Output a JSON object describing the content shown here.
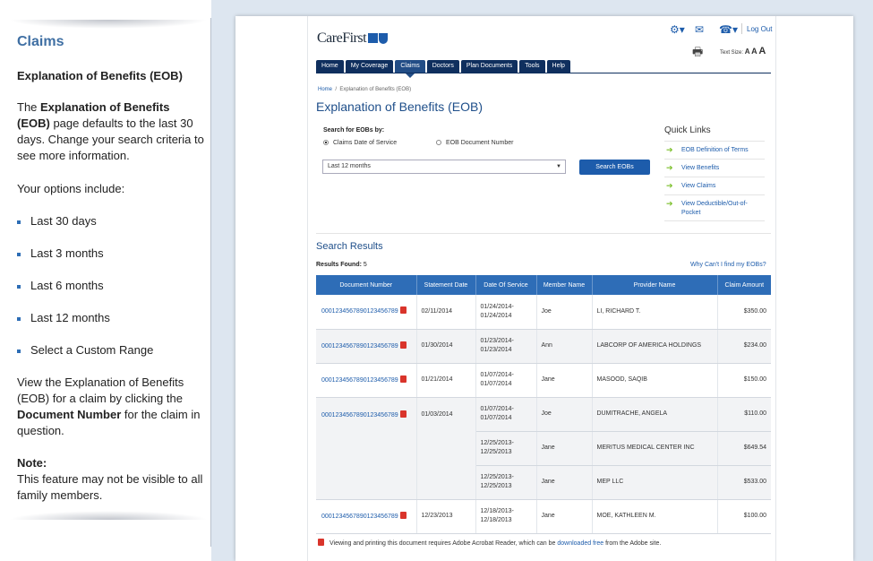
{
  "help": {
    "title": "Claims",
    "subtitle": "Explanation of Benefits (EOB)",
    "intro_prefix": "The ",
    "intro_bold": "Explanation of Benefits (EOB)",
    "intro_suffix": " page defaults to the last 30 days. Change your search criteria to see more information.",
    "options_heading": "Your options include:",
    "options": [
      "Last 30 days",
      "Last 3 months",
      "Last 6 months",
      "Last 12 months",
      "Select a Custom Range"
    ],
    "view_prefix": "View the Explanation of Benefits (EOB) for a claim by clicking the ",
    "view_bold": "Document Number",
    "view_suffix": " for the claim in question.",
    "note_label": "Note:",
    "note_text": "This feature may not be visible to all family members."
  },
  "site": {
    "logo": "CareFirst",
    "logout": "Log Out",
    "text_size_label": "Text Size:",
    "text_size_options": [
      "A",
      "A",
      "A"
    ],
    "icons": [
      "gear-icon",
      "mail-icon",
      "phone-icon",
      "print-icon"
    ],
    "nav": [
      "Home",
      "My Coverage",
      "Claims",
      "Doctors",
      "Plan Documents",
      "Tools",
      "Help"
    ],
    "active_tab": "Claims",
    "breadcrumb": {
      "home": "Home",
      "sep": "/",
      "current": "Explanation of Benefits (EOB)"
    },
    "page_title": "Explanation of Benefits (EOB)"
  },
  "search": {
    "label": "Search for EOBs by:",
    "radio_1": "Claims Date of Service",
    "radio_2": "EOB Document Number",
    "selected_range": "Last 12 months",
    "button": "Search EOBs"
  },
  "quick_links": {
    "title": "Quick Links",
    "items": [
      "EOB Definition of Terms",
      "View Benefits",
      "View Claims",
      "View Deductible/Out-of-Pocket"
    ]
  },
  "results": {
    "heading": "Search Results",
    "found_label": "Results Found:",
    "found_count": "5",
    "why_link": "Why Can't I find my EOBs?",
    "columns": [
      "Document Number",
      "Statement Date",
      "Date Of Service",
      "Member Name",
      "Provider Name",
      "Claim Amount"
    ],
    "rows": [
      {
        "doc": "00012345678901234567​89",
        "statement": "02/11/2014",
        "service_1": "01/24/2014-",
        "service_2": "01/24/2014",
        "member": "Joe",
        "provider": "LI, RICHARD T.",
        "amount": "$350.00"
      },
      {
        "doc": "00012345678901234567​89",
        "statement": "01/30/2014",
        "service_1": "01/23/2014-",
        "service_2": "01/23/2014",
        "member": "Ann",
        "provider": "LABCORP OF AMERICA HOLDINGS",
        "amount": "$234.00"
      },
      {
        "doc": "00012345678901234567​89",
        "statement": "01/21/2014",
        "service_1": "01/07/2014-",
        "service_2": "01/07/2014",
        "member": "Jane",
        "provider": "MASOOD, SAQIB",
        "amount": "$150.00"
      },
      {
        "doc": "00012345678901234567​89",
        "statement": "01/03/2014",
        "service_1": "01/07/2014-",
        "service_2": "01/07/2014",
        "member": "Joe",
        "provider": "DUMITRACHE, ANGELA",
        "amount": "$110.00"
      },
      {
        "doc": "",
        "statement": "",
        "service_1": "12/25/2013-",
        "service_2": "12/25/2013",
        "member": "Jane",
        "provider": "MERITUS MEDICAL CENTER INC",
        "amount": "$649.54"
      },
      {
        "doc": "",
        "statement": "",
        "service_1": "12/25/2013-",
        "service_2": "12/25/2013",
        "member": "Jane",
        "provider": "MEP LLC",
        "amount": "$533.00"
      },
      {
        "doc": "00012345678901234567​89",
        "statement": "12/23/2013",
        "service_1": "12/18/2013-",
        "service_2": "12/18/2013",
        "member": "Jane",
        "provider": "MOE, KATHLEEN M.",
        "amount": "$100.00"
      }
    ]
  },
  "footer": {
    "prefix": "Viewing and printing this document requires Adobe Acrobat Reader, which can be ",
    "link": "downloaded free",
    "suffix": " from the Adobe site."
  }
}
